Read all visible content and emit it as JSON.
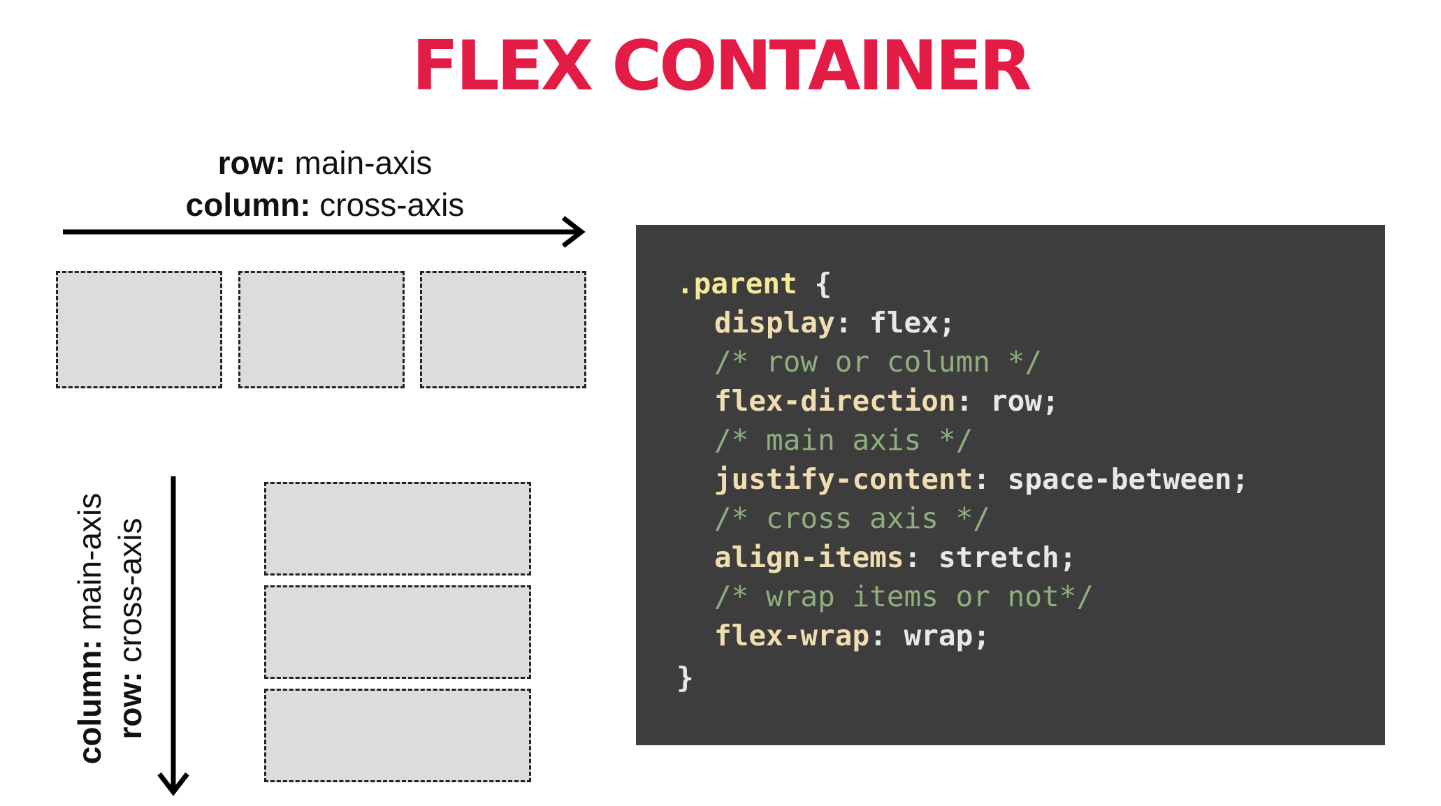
{
  "title": "FLEX CONTAINER",
  "row_axis": {
    "line1_bold": "row:",
    "line1_text": " main-axis",
    "line2_bold": "column:",
    "line2_text": " cross-axis"
  },
  "column_axis": {
    "line1_bold": "column:",
    "line1_text": " main-axis",
    "line2_bold": "row:",
    "line2_text": " cross-axis"
  },
  "code": {
    "selector": ".parent",
    "open_brace": " {",
    "close_brace": "}",
    "lines": [
      {
        "type": "decl",
        "prop": "display",
        "value": "flex;"
      },
      {
        "type": "comment",
        "text": "/* row or column */"
      },
      {
        "type": "decl",
        "prop": "flex-direction",
        "value": "row;"
      },
      {
        "type": "comment",
        "text": "/* main axis */"
      },
      {
        "type": "decl",
        "prop": "justify-content",
        "value": "space-between;"
      },
      {
        "type": "comment",
        "text": "/* cross axis */"
      },
      {
        "type": "decl",
        "prop": "align-items",
        "value": "stretch;"
      },
      {
        "type": "comment",
        "text": "/* wrap items or not*/"
      },
      {
        "type": "decl",
        "prop": "flex-wrap",
        "value": "wrap;"
      }
    ]
  },
  "colors": {
    "title": "#e31c46",
    "panel_bg": "#3d3d3d",
    "selector": "#f4ea9a",
    "property": "#f0ddb0",
    "comment": "#8fae7d",
    "box_fill": "#dcdcdc"
  }
}
